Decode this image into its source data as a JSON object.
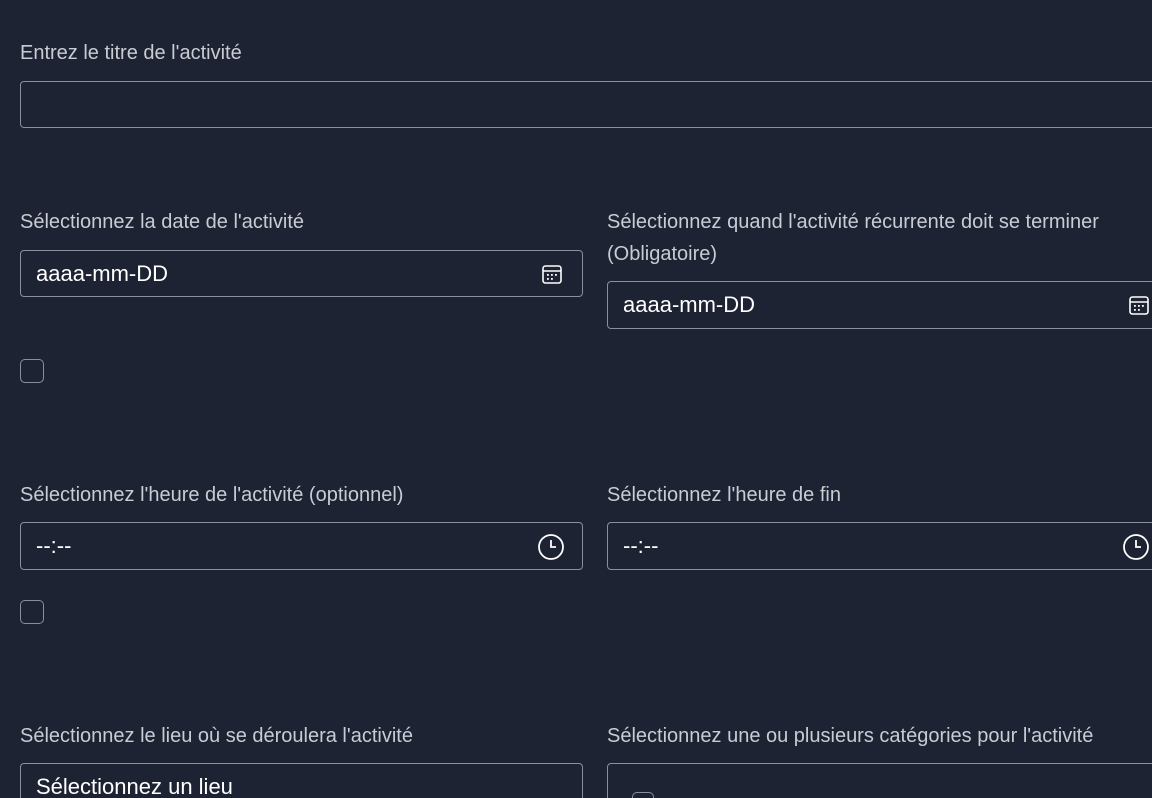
{
  "title_field": {
    "label": "Entrez le titre de l'activité",
    "value": ""
  },
  "date_field": {
    "label": "Sélectionnez la date de l'activité",
    "placeholder": "aaaa-mm-DD",
    "icon": "calendar-icon"
  },
  "recurrence_end_field": {
    "label": "Sélectionnez quand l'activité récurrente doit se terminer (Obligatoire)",
    "placeholder": "aaaa-mm-DD",
    "icon": "calendar-icon"
  },
  "time_field": {
    "label": "Sélectionnez l'heure de l'activité (optionnel)",
    "placeholder": "--:--",
    "icon": "clock-icon"
  },
  "end_time_field": {
    "label": "Sélectionnez l'heure de fin",
    "placeholder": "--:--",
    "icon": "clock-icon"
  },
  "location_field": {
    "label": "Sélectionnez le lieu où se déroulera l'activité",
    "selected": "Sélectionnez un lieu"
  },
  "categories_field": {
    "label": "Sélectionnez une ou plusieurs catégories pour l'activité"
  },
  "colors": {
    "background": "#1e2333",
    "border": "#8a8f9c",
    "label": "#c9ccd3",
    "value": "#ffffff"
  }
}
